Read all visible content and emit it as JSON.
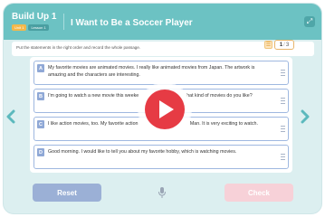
{
  "header": {
    "title": "Build Up 1",
    "unit_tag": "Unit 1",
    "lesson_tag": "Lesson 1",
    "lesson_title": "I Want to Be a Soccer Player"
  },
  "instruction": "Put the statements in the right order and record the whole passage.",
  "pagination": {
    "current": "1",
    "total": "3"
  },
  "items": [
    {
      "letter": "A",
      "text": "My favorite movies are animated movies. I really like animated movies from Japan. The artwork is amazing and the characters are interesting."
    },
    {
      "letter": "B",
      "text": "I'm going to watch a new movie this weeke                                    hat kind of movies do you like?"
    },
    {
      "letter": "C",
      "text": "I like action movies, too. My favorite action                                       Man. It is very exciting to watch."
    },
    {
      "letter": "D",
      "text": "Good morning. I would like to tell you about my favorite hobby, which is watching movies."
    }
  ],
  "buttons": {
    "reset": "Reset",
    "check": "Check"
  },
  "colors": {
    "header": "#6cc2c3",
    "reset": "#9bb0d6",
    "check": "#f7d1d8",
    "play": "#e63b44"
  },
  "icons": {
    "fullscreen": "fullscreen-icon",
    "hint": "hint-icon",
    "prev": "chevron-left-icon",
    "next": "chevron-right-icon",
    "mic": "microphone-icon",
    "play": "play-icon"
  }
}
